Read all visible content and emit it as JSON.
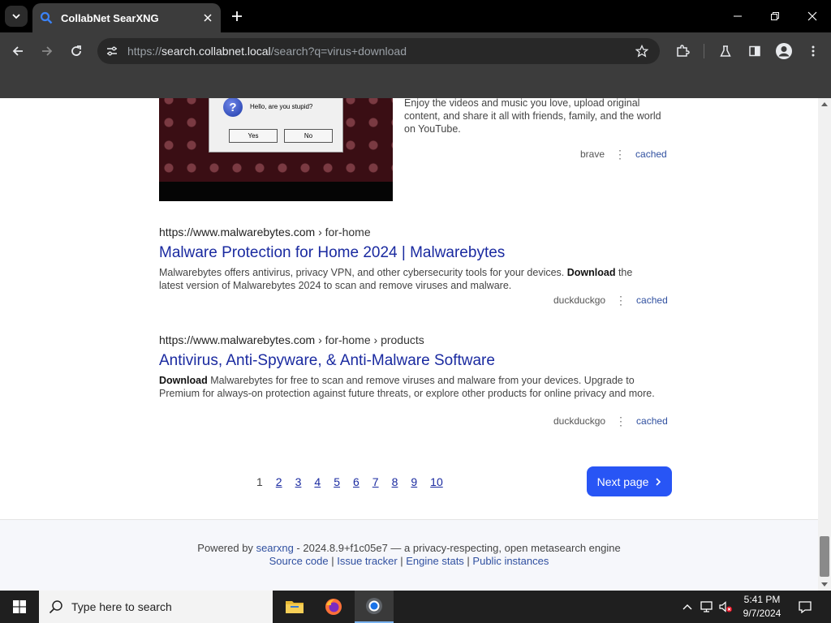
{
  "browser": {
    "tab_title": "CollabNet SearXNG",
    "url_scheme": "https://",
    "url_host": "search.collabnet.local",
    "url_path": "/search?q=virus+download"
  },
  "results": {
    "video": {
      "dialog_message": "Hello, are you stupid?",
      "dialog_yes": "Yes",
      "dialog_no": "No",
      "description": "Enjoy the videos and music you love, upload original content, and share it all with friends, family, and the world on YouTube.",
      "engine": "brave",
      "cached": "cached"
    },
    "items": [
      {
        "url": "https://www.malwarebytes.com",
        "crumbs": "› for-home",
        "title": "Malware Protection for Home 2024 | Malwarebytes",
        "desc_before": "Malwarebytes offers antivirus, privacy VPN, and other cybersecurity tools for your devices. ",
        "desc_bold": "Download",
        "desc_after": " the latest version of Malwarebytes 2024 to scan and remove viruses and malware.",
        "engine": "duckduckgo",
        "cached": "cached"
      },
      {
        "url": "https://www.malwarebytes.com",
        "crumbs": "› for-home › products",
        "title": "Antivirus, Anti-Spyware, & Anti-Malware Software",
        "desc_bold": "Download",
        "desc_after": " Malwarebytes for free to scan and remove viruses and malware from your devices. Upgrade to Premium for always-on protection against future threats, or explore other products for online privacy and more.",
        "engine": "duckduckgo",
        "cached": "cached"
      }
    ]
  },
  "pagination": {
    "pages": [
      "1",
      "2",
      "3",
      "4",
      "5",
      "6",
      "7",
      "8",
      "9",
      "10"
    ],
    "current": "1",
    "next_label": "Next page"
  },
  "footer": {
    "powered_by": "Powered by",
    "searxng": "searxng",
    "version_text": " - 2024.8.9+f1c05e7 — a privacy-respecting, open metasearch engine",
    "source_code": "Source code",
    "issue_tracker": "Issue tracker",
    "engine_stats": "Engine stats",
    "public_instances": "Public instances",
    "sep": " | "
  },
  "taskbar": {
    "search_placeholder": "Type here to search",
    "time": "5:41 PM",
    "date": "9/7/2024"
  },
  "colors": {
    "link": "#1a2aa0",
    "next_button": "#2855f5",
    "chrome_dark": "#3c3c3c"
  }
}
